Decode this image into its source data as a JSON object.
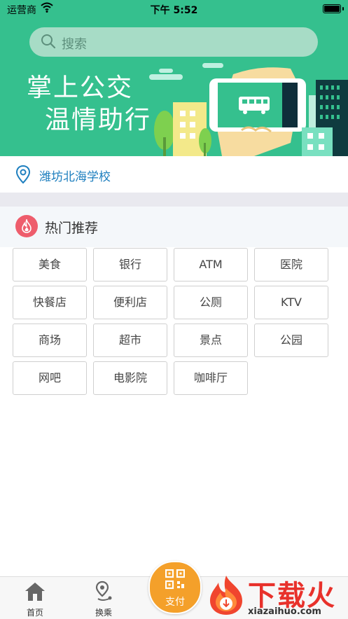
{
  "status_bar": {
    "carrier": "运营商",
    "time": "下午 5:52"
  },
  "search": {
    "placeholder": "搜索"
  },
  "banner": {
    "slogan_line1": "掌上公交",
    "slogan_line2": "温情助行"
  },
  "location": {
    "name": "潍坊北海学校"
  },
  "hot": {
    "title": "热门推荐",
    "items": [
      "美食",
      "银行",
      "ATM",
      "医院",
      "快餐店",
      "便利店",
      "公厕",
      "KTV",
      "商场",
      "超市",
      "景点",
      "公园",
      "网吧",
      "电影院",
      "咖啡厅"
    ]
  },
  "tabbar": {
    "home": "首页",
    "transfer": "换乘",
    "pay": "支付"
  },
  "watermark": {
    "brand": "下载火",
    "url": "xiazaihuo.com"
  },
  "colors": {
    "header_green": "#35c08e",
    "location_blue": "#1e7fbf",
    "pay_orange": "#f4a02a",
    "fire_red": "#ee5d6c"
  }
}
